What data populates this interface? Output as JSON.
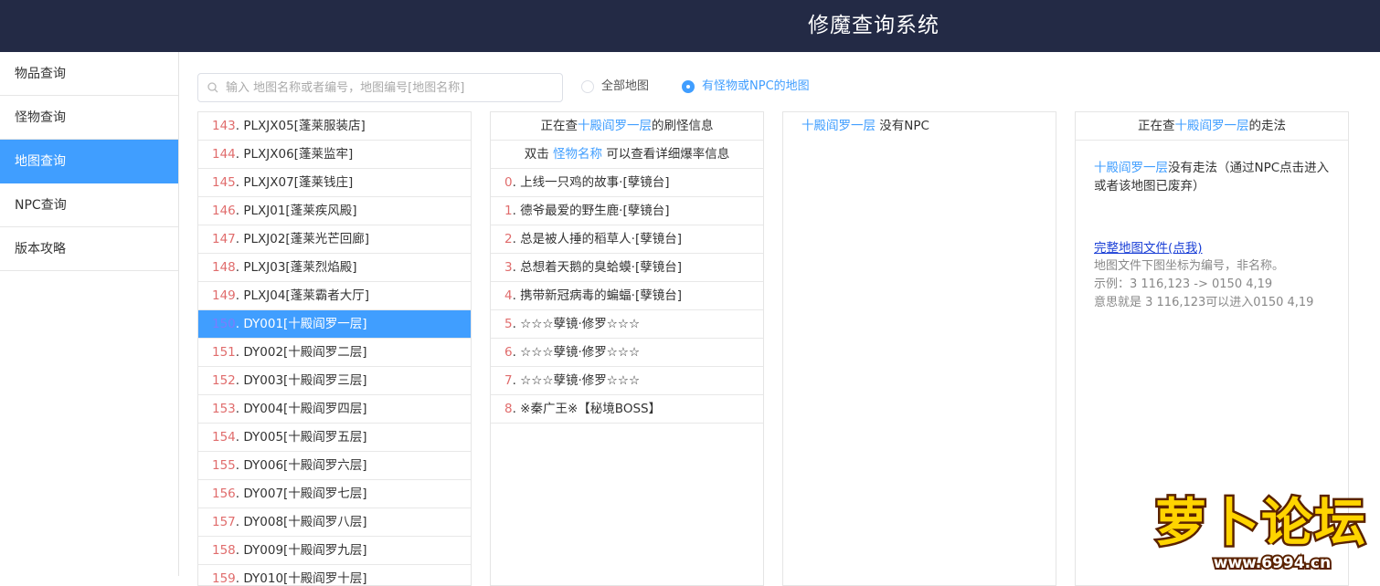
{
  "header": {
    "title": "修魔查询系统"
  },
  "sidebar": {
    "items": [
      {
        "label": "物品查询",
        "active": false
      },
      {
        "label": "怪物查询",
        "active": false
      },
      {
        "label": "地图查询",
        "active": true
      },
      {
        "label": "NPC查询",
        "active": false
      },
      {
        "label": "版本攻略",
        "active": false
      }
    ]
  },
  "search": {
    "placeholder": "输入 地图名称或者编号，地图编号[地图名称]",
    "value": ""
  },
  "filters": {
    "all_maps": {
      "label": "全部地图",
      "selected": false
    },
    "with_monster": {
      "label": "有怪物或NPC的地图",
      "selected": true
    }
  },
  "map_list": [
    {
      "num": "143",
      "name": ". PLXJX05[蓬莱服装店]"
    },
    {
      "num": "144",
      "name": ". PLXJX06[蓬莱监牢]"
    },
    {
      "num": "145",
      "name": ". PLXJX07[蓬莱钱庄]"
    },
    {
      "num": "146",
      "name": ". PLXJ01[蓬莱疾风殿]"
    },
    {
      "num": "147",
      "name": ". PLXJ02[蓬莱光芒回廊]"
    },
    {
      "num": "148",
      "name": ". PLXJ03[蓬莱烈焰殿]"
    },
    {
      "num": "149",
      "name": ". PLXJ04[蓬莱霸者大厅]"
    },
    {
      "num": "150",
      "name": ". DY001[十殿阎罗一层]",
      "selected": true
    },
    {
      "num": "151",
      "name": ". DY002[十殿阎罗二层]"
    },
    {
      "num": "152",
      "name": ". DY003[十殿阎罗三层]"
    },
    {
      "num": "153",
      "name": ". DY004[十殿阎罗四层]"
    },
    {
      "num": "154",
      "name": ". DY005[十殿阎罗五层]"
    },
    {
      "num": "155",
      "name": ". DY006[十殿阎罗六层]"
    },
    {
      "num": "156",
      "name": ". DY007[十殿阎罗七层]"
    },
    {
      "num": "157",
      "name": ". DY008[十殿阎罗八层]"
    },
    {
      "num": "158",
      "name": ". DY009[十殿阎罗九层]"
    },
    {
      "num": "159",
      "name": ". DY010[十殿阎罗十层]"
    }
  ],
  "monster_panel": {
    "head_prefix": "正在查",
    "map_name": "十殿阎罗一层",
    "head_suffix": "的刷怪信息",
    "hint_prefix": "双击 ",
    "hint_link": "怪物名称",
    "hint_suffix": " 可以查看详细爆率信息",
    "monsters": [
      {
        "num": "0",
        "name": ". 上线一只鸡的故事·[孽镜台]"
      },
      {
        "num": "1",
        "name": ". 德爷最爱的野生鹿·[孽镜台]"
      },
      {
        "num": "2",
        "name": ". 总是被人捶的稻草人·[孽镜台]"
      },
      {
        "num": "3",
        "name": ". 总想着天鹅的臭蛤蟆·[孽镜台]"
      },
      {
        "num": "4",
        "name": ". 携带新冠病毒的蝙蝠·[孽镜台]"
      },
      {
        "num": "5",
        "name": ". ☆☆☆孽镜·修罗☆☆☆"
      },
      {
        "num": "6",
        "name": ". ☆☆☆孽镜·修罗☆☆☆"
      },
      {
        "num": "7",
        "name": ". ☆☆☆孽镜·修罗☆☆☆"
      },
      {
        "num": "8",
        "name": ". ※秦广王※【秘境BOSS】"
      }
    ]
  },
  "npc_panel": {
    "map_name": "十殿阎罗一层",
    "text": " 没有NPC"
  },
  "route_panel": {
    "head_prefix": "正在查",
    "map_name": "十殿阎罗一层",
    "head_suffix": "的走法",
    "body_map_name": "十殿阎罗一层",
    "body_text": "没有走法（通过NPC点击进入或者该地图已废弃）",
    "link": "完整地图文件(点我)",
    "note1": "地图文件下图坐标为编号，非名称。",
    "note2": "示例：3 116,123 -> 0150 4,19",
    "note3": "意思就是 3 116,123可以进入0150 4,19"
  },
  "watermark": {
    "text": "萝卜论坛",
    "site": "www.6994.cn"
  },
  "colors": {
    "header_bg": "#232a45",
    "accent": "#409eff",
    "number": "#e06c6c"
  }
}
